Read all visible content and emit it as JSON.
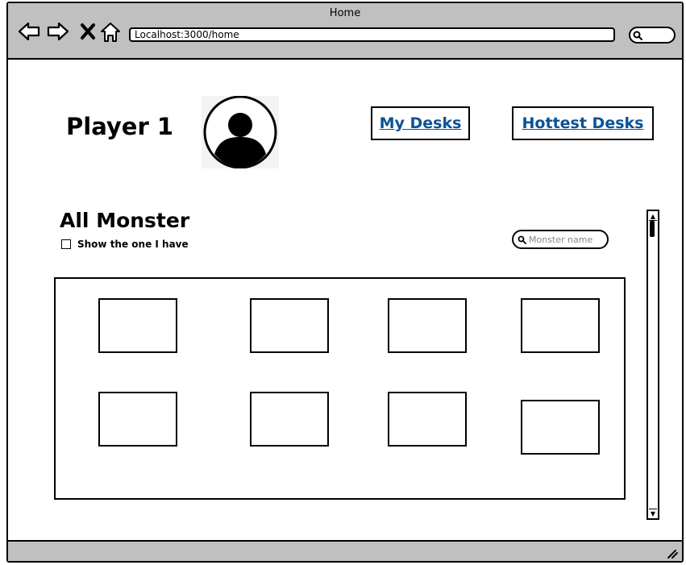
{
  "window": {
    "title": "Home"
  },
  "browser": {
    "url": "Localhost:3000/home",
    "nav_icons": [
      "back-icon",
      "forward-icon",
      "close-icon",
      "home-icon"
    ]
  },
  "header": {
    "player_name": "Player 1",
    "links": [
      "My Desks",
      "Hottest Desks"
    ]
  },
  "monsters": {
    "title": "All Monster",
    "filter_label": "Show the one I have",
    "filter_checked": false,
    "search_placeholder": "Monster name",
    "cards_visible": 8
  },
  "colors": {
    "chrome": "#c0c0c0",
    "link": "#0b5394"
  }
}
